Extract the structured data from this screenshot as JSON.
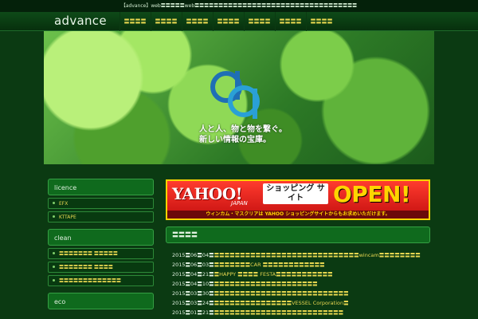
{
  "topbar": {
    "text": "【advance】web〓〓〓〓〓web〓〓〓〓〓〓〓〓〓〓〓〓〓〓〓〓〓〓〓〓〓〓〓〓〓〓〓〓〓〓〓〓〓〓"
  },
  "header": {
    "logo": "advance",
    "nav": [
      "〓〓〓〓",
      "〓〓〓〓",
      "〓〓〓〓",
      "〓〓〓〓",
      "〓〓〓〓",
      "〓〓〓〓",
      "〓〓〓〓"
    ]
  },
  "hero": {
    "line1": "人と人、物と物を繋ぐ。",
    "line2": "新しい情報の宝庫。",
    "logo_colors": [
      "#1f6fb5",
      "#2aa0d6"
    ]
  },
  "sidebar": {
    "groups": [
      {
        "title": "licence",
        "items": [
          "EFX",
          "KTTAPE"
        ]
      },
      {
        "title": "clean",
        "items": [
          "〓〓〓〓〓〓〓 〓〓〓〓〓",
          "〓〓〓〓〓〓〓 〓〓〓〓",
          "〓〓〓〓〓〓〓〓〓〓〓〓〓"
        ]
      },
      {
        "title": "eco",
        "items": []
      }
    ]
  },
  "banner": {
    "brand": "YAHOO!",
    "brand_sub": "JAPAN",
    "shop": "ショッピング サイト",
    "open": "OPEN!",
    "sub": "ウィンカム・マスクリアは YAHOO ショッピングサイトからもお求めいただけます。"
  },
  "news": {
    "title": "〓〓〓〓",
    "items": [
      {
        "date": "2015〓06〓04〓",
        "title": "〓〓〓〓〓〓〓〓〓〓〓〓〓〓〓〓〓〓〓〓〓〓〓〓〓〓〓〓wincam〓〓〓〓〓〓〓〓"
      },
      {
        "date": "2015〓06〓03〓",
        "title": "〓〓〓〓〓〓〓CAR 〓〓〓〓〓〓〓〓〓〓〓〓"
      },
      {
        "date": "2015〓04〓21〓",
        "title": "〓HAPPY 〓〓〓〓 FESTA〓〓〓〓〓〓〓〓〓〓〓"
      },
      {
        "date": "2015〓04〓10〓",
        "title": "〓〓〓〓〓〓〓〓〓〓〓〓〓〓〓〓〓〓〓〓"
      },
      {
        "date": "2015〓03〓30〓",
        "title": "〓〓〓〓〓〓〓〓〓〓〓〓〓〓〓〓〓〓〓〓〓〓〓〓〓〓"
      },
      {
        "date": "2015〓03〓24〓",
        "title": "〓〓〓〓〓〓〓〓〓〓〓〓〓〓〓VESSEL Corporation〓"
      },
      {
        "date": "2015〓01〓21〓",
        "title": "〓〓〓〓〓〓〓〓〓〓〓〓〓〓〓〓〓〓〓〓〓〓〓〓〓"
      }
    ]
  }
}
